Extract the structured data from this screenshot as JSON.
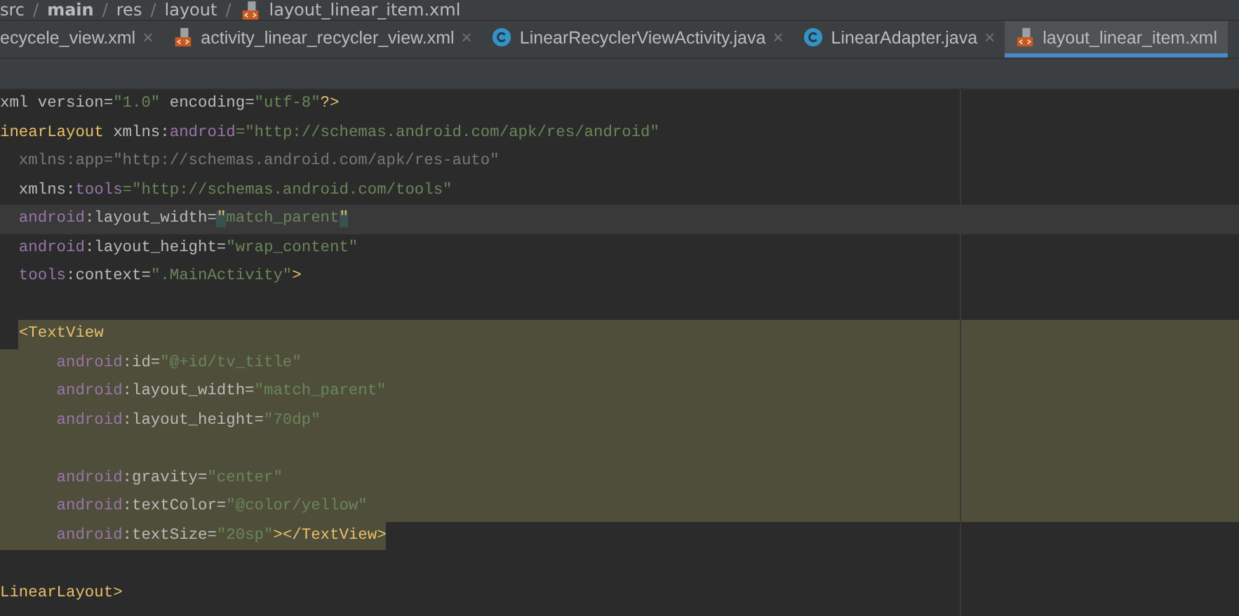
{
  "breadcrumb": {
    "separator": "/",
    "items": [
      {
        "label": "src",
        "bold": false,
        "kind": "folder"
      },
      {
        "label": "main",
        "bold": true,
        "kind": "folder"
      },
      {
        "label": "res",
        "bold": false,
        "kind": "folder"
      },
      {
        "label": "layout",
        "bold": false,
        "kind": "folder"
      },
      {
        "label": "layout_linear_item.xml",
        "bold": false,
        "kind": "xml"
      }
    ]
  },
  "tabs": [
    {
      "label": "ecycele_view.xml",
      "close": "×",
      "selected": false
    },
    {
      "label": "activity_linear_recycler_view.xml",
      "kind": "xml",
      "close": "×",
      "selected": false
    },
    {
      "label": "LinearRecyclerViewActivity.java",
      "kind": "class",
      "close": "×",
      "selected": false
    },
    {
      "label": "LinearAdapter.java",
      "kind": "class",
      "close": "×",
      "selected": false
    },
    {
      "label": "layout_linear_item.xml",
      "kind": "xml",
      "selected": true
    }
  ],
  "editor": {
    "lines": [
      {
        "current": false,
        "selected": false,
        "segments": [
          {
            "kind": "plain",
            "text": "xml version="
          },
          {
            "kind": "value",
            "text": "\"1.0\""
          },
          {
            "kind": "plain",
            "text": " encoding="
          },
          {
            "kind": "value",
            "text": "\"utf-8\""
          },
          {
            "kind": "tag",
            "text": "?>"
          }
        ]
      },
      {
        "current": false,
        "selected": false,
        "segments": [
          {
            "kind": "tag",
            "text": "inearLayout "
          },
          {
            "kind": "plain",
            "text": "xmlns:"
          },
          {
            "kind": "ns",
            "text": "android"
          },
          {
            "kind": "value",
            "text": "=\"http://schemas.android.com/apk/res/android\""
          }
        ]
      },
      {
        "current": false,
        "selected": false,
        "segments": [
          {
            "kind": "unused",
            "text": "  xmlns:app=\"http://schemas.android.com/apk/res-auto\""
          }
        ]
      },
      {
        "current": false,
        "selected": false,
        "segments": [
          {
            "kind": "plain",
            "text": "  xmlns:"
          },
          {
            "kind": "ns",
            "text": "tools"
          },
          {
            "kind": "value",
            "text": "=\"http://schemas.android.com/tools\""
          }
        ]
      },
      {
        "current": true,
        "selected": false,
        "segments": [
          {
            "kind": "ns",
            "text": "  android"
          },
          {
            "kind": "plain",
            "text": ":layout_width="
          },
          {
            "kind": "match",
            "text": "\""
          },
          {
            "kind": "value",
            "text": "match_parent"
          },
          {
            "kind": "match",
            "text": "\""
          }
        ]
      },
      {
        "current": false,
        "selected": false,
        "segments": [
          {
            "kind": "ns",
            "text": "  android"
          },
          {
            "kind": "plain",
            "text": ":layout_height="
          },
          {
            "kind": "value",
            "text": "\"wrap_content\""
          }
        ]
      },
      {
        "current": false,
        "selected": false,
        "segments": [
          {
            "kind": "ns",
            "text": "  tools"
          },
          {
            "kind": "plain",
            "text": ":context="
          },
          {
            "kind": "value",
            "text": "\".MainActivity\""
          },
          {
            "kind": "tag",
            "text": ">"
          }
        ]
      },
      {
        "current": false,
        "selected": false
      },
      {
        "current": false,
        "selected": true,
        "segments": [
          {
            "kind": "tag",
            "text": "  <TextView"
          }
        ]
      },
      {
        "current": false,
        "selected": true,
        "segments": [
          {
            "kind": "ns",
            "text": "      android"
          },
          {
            "kind": "plain",
            "text": ":id="
          },
          {
            "kind": "value",
            "text": "\"@+id/tv_title\""
          }
        ]
      },
      {
        "current": false,
        "selected": true,
        "segments": [
          {
            "kind": "ns",
            "text": "      android"
          },
          {
            "kind": "plain",
            "text": ":layout_width="
          },
          {
            "kind": "value",
            "text": "\"match_parent\""
          }
        ]
      },
      {
        "current": false,
        "selected": true,
        "segments": [
          {
            "kind": "ns",
            "text": "      android"
          },
          {
            "kind": "plain",
            "text": ":layout_height="
          },
          {
            "kind": "value",
            "text": "\"70dp\""
          }
        ]
      },
      {
        "current": false,
        "selected": true
      },
      {
        "current": false,
        "selected": true,
        "segments": [
          {
            "kind": "ns",
            "text": "      android"
          },
          {
            "kind": "plain",
            "text": ":gravity="
          },
          {
            "kind": "value",
            "text": "\"center\""
          }
        ]
      },
      {
        "current": false,
        "selected": true,
        "segments": [
          {
            "kind": "ns",
            "text": "      android"
          },
          {
            "kind": "plain",
            "text": ":textColor="
          },
          {
            "kind": "value",
            "text": "\"@color/yellow\""
          }
        ]
      },
      {
        "current": false,
        "selected": true,
        "segments": [
          {
            "kind": "ns",
            "text": "      android"
          },
          {
            "kind": "plain",
            "text": ":textSize="
          },
          {
            "kind": "value",
            "text": "\"20sp\""
          },
          {
            "kind": "tag",
            "text": "></TextView>"
          }
        ]
      },
      {
        "current": false,
        "selected": false
      },
      {
        "current": false,
        "selected": false,
        "segments": [
          {
            "kind": "tag",
            "text": "LinearLayout>"
          }
        ]
      }
    ]
  }
}
